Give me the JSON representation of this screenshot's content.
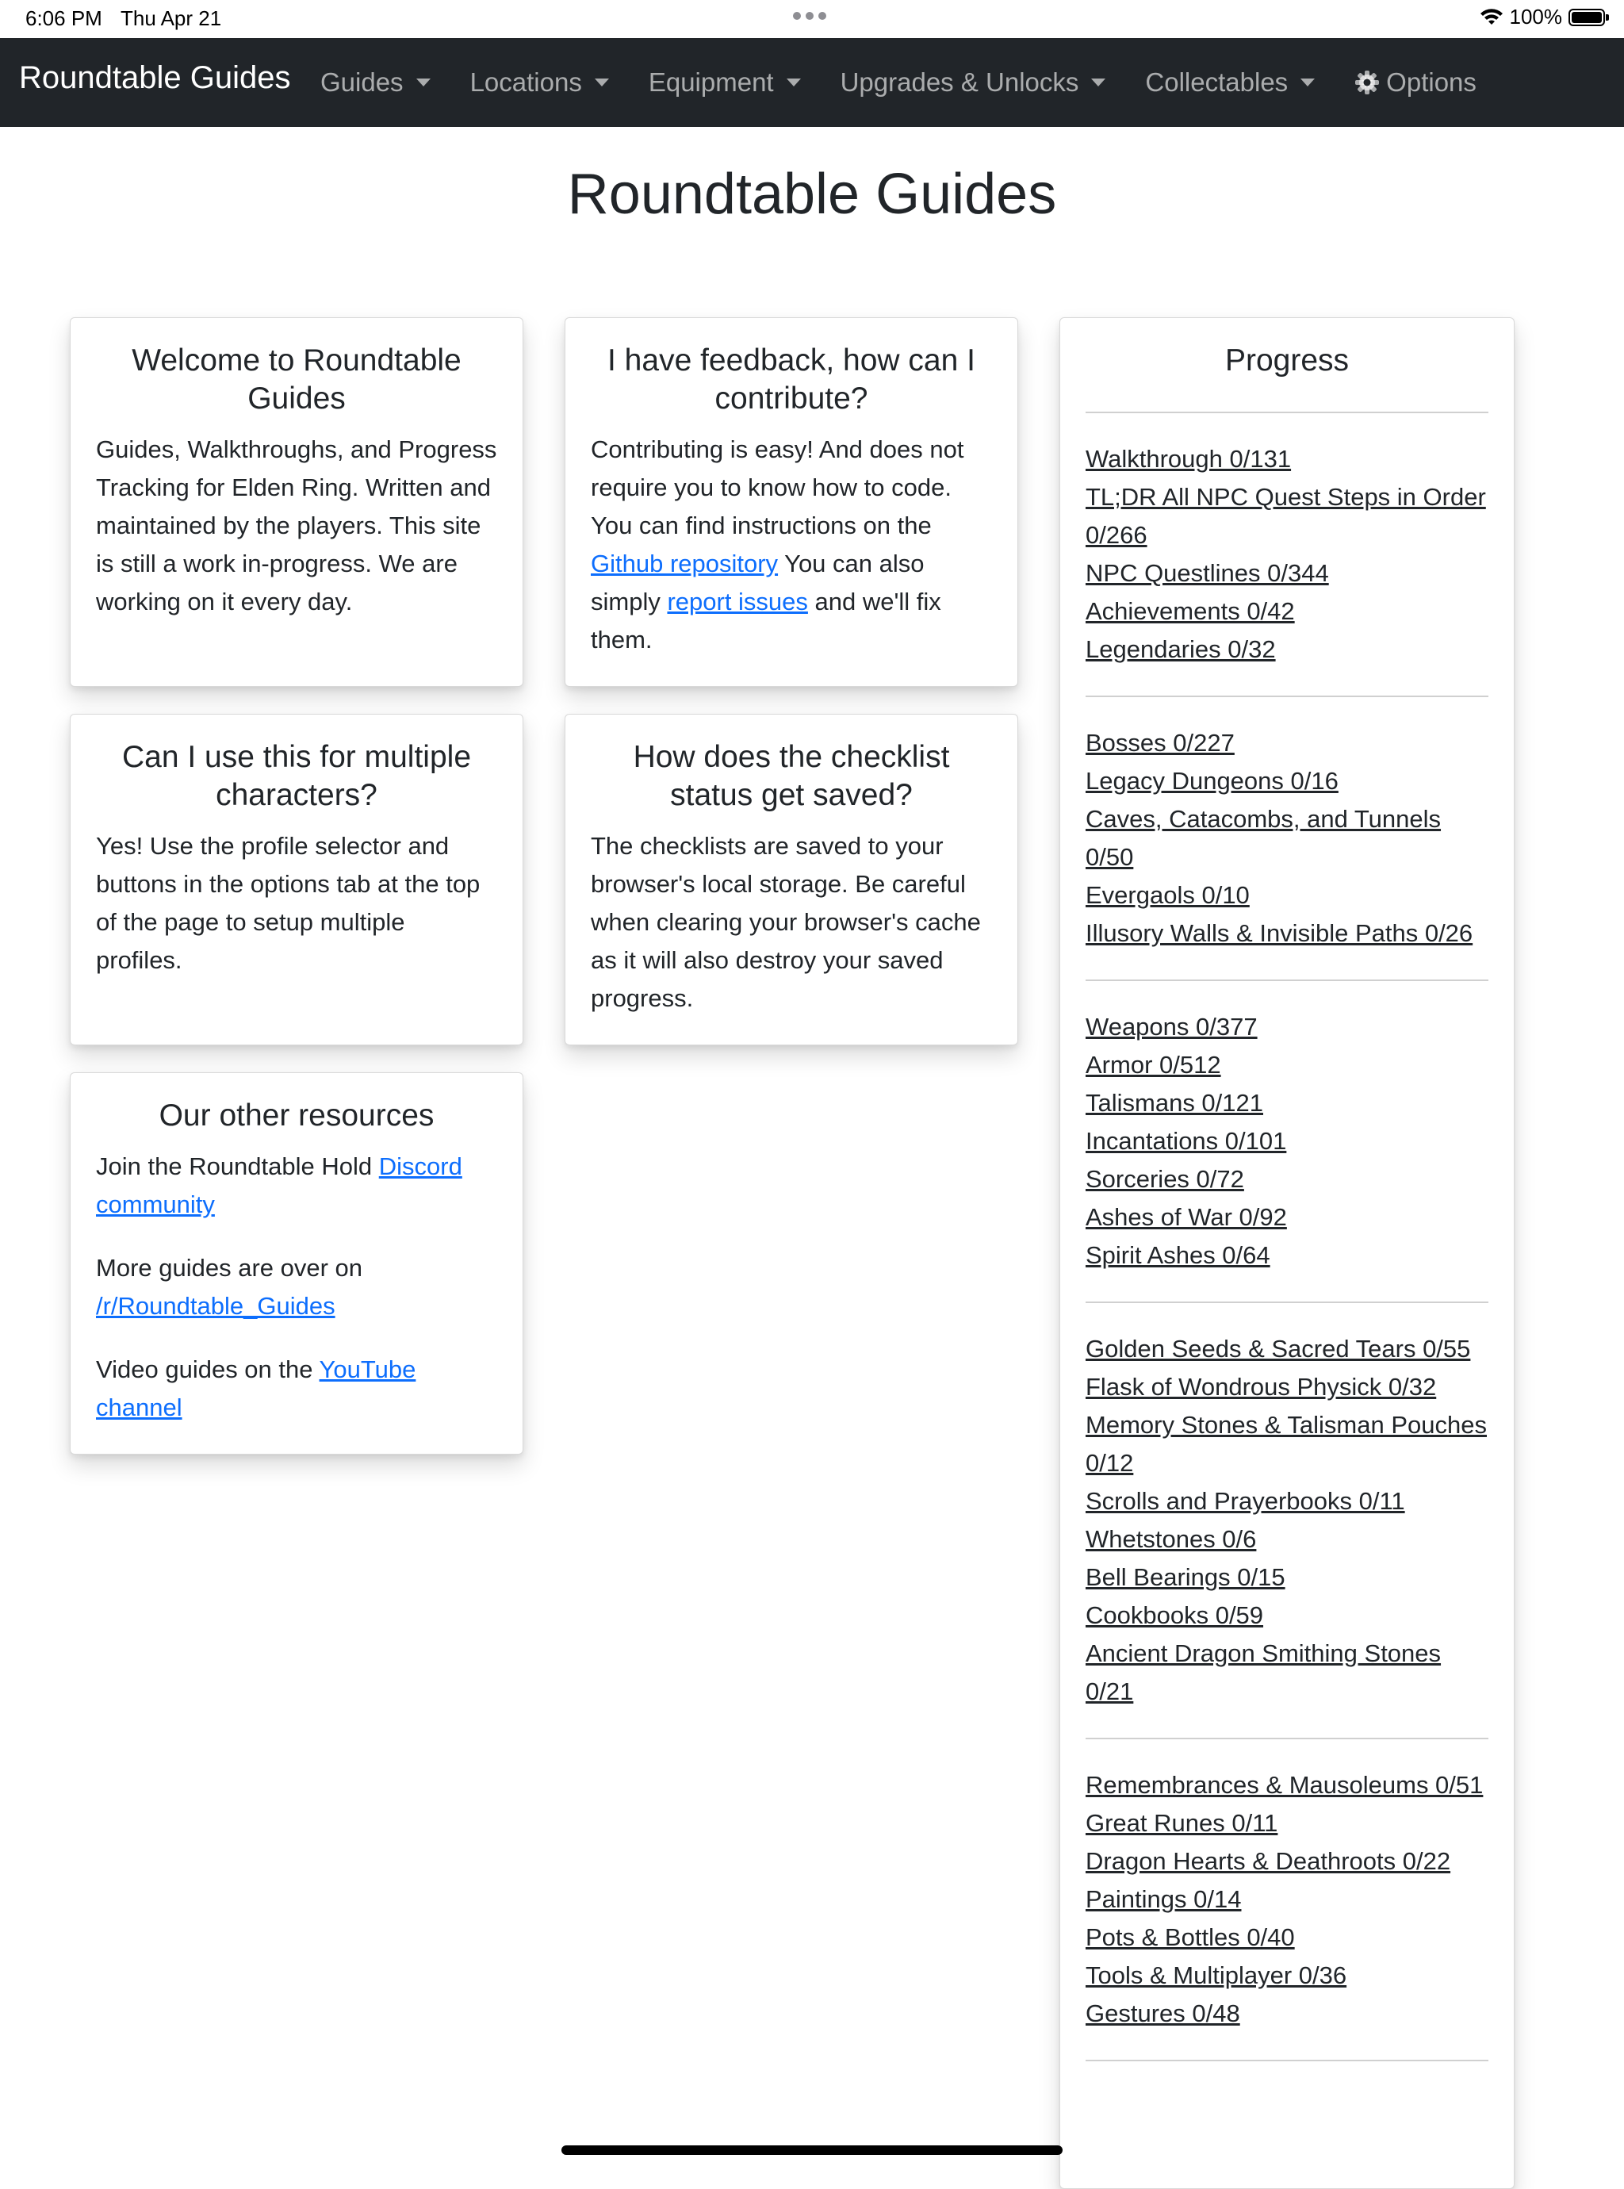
{
  "status_bar": {
    "time": "6:06 PM",
    "date": "Thu Apr 21",
    "battery": "100%"
  },
  "navbar": {
    "brand": "Roundtable Guides",
    "items": [
      {
        "label": "Guides"
      },
      {
        "label": "Locations"
      },
      {
        "label": "Equipment"
      },
      {
        "label": "Upgrades & Unlocks"
      },
      {
        "label": "Collectables"
      },
      {
        "label": "Options"
      }
    ]
  },
  "page_title": "Roundtable Guides",
  "cards": {
    "welcome": {
      "title": "Welcome to Roundtable Guides",
      "text": "Guides, Walkthroughs, and Progress Tracking for Elden Ring. Written and maintained by the players. This site is still a work in-progress. We are working on it every day."
    },
    "feedback": {
      "title": "I have feedback, how can I contribute?",
      "text1": "Contributing is easy! And does not require you to know how to code. You can find instructions on the ",
      "link1": "Github repository",
      "text2": " You can also simply ",
      "link2": "report issues",
      "text3": " and we'll fix them."
    },
    "multiple": {
      "title": "Can I use this for multiple characters?",
      "text": "Yes! Use the profile selector and buttons in the options tab at the top of the page to setup multiple profiles."
    },
    "checklist": {
      "title": "How does the checklist status get saved?",
      "text": "The checklists are saved to your browser's local storage. Be careful when clearing your browser's cache as it will also destroy your saved progress."
    },
    "resources": {
      "title": "Our other resources",
      "discord_pre": "Join the Roundtable Hold ",
      "discord_link": "Discord community",
      "reddit_pre": "More guides are over on ",
      "reddit_link": "/r/Roundtable_Guides",
      "youtube_pre": "Video guides on the ",
      "youtube_link": "YouTube channel"
    }
  },
  "progress": {
    "title": "Progress",
    "groups": [
      [
        "Walkthrough 0/131",
        "TL;DR All NPC Quest Steps in Order 0/266",
        "NPC Questlines 0/344",
        "Achievements 0/42",
        "Legendaries 0/32"
      ],
      [
        "Bosses 0/227",
        "Legacy Dungeons 0/16",
        "Caves, Catacombs, and Tunnels 0/50",
        "Evergaols 0/10",
        "Illusory Walls & Invisible Paths 0/26"
      ],
      [
        "Weapons 0/377",
        "Armor 0/512",
        "Talismans 0/121",
        "Incantations 0/101",
        "Sorceries 0/72",
        "Ashes of War 0/92",
        "Spirit Ashes 0/64"
      ],
      [
        "Golden Seeds & Sacred Tears 0/55",
        "Flask of Wondrous Physick 0/32",
        "Memory Stones & Talisman Pouches 0/12",
        "Scrolls and Prayerbooks 0/11",
        "Whetstones 0/6",
        "Bell Bearings 0/15",
        "Cookbooks 0/59",
        "Ancient Dragon Smithing Stones 0/21"
      ],
      [
        "Remembrances & Mausoleums 0/51",
        "Great Runes 0/11",
        "Dragon Hearts & Deathroots 0/22",
        "Paintings 0/14",
        "Pots & Bottles 0/40",
        "Tools & Multiplayer 0/36",
        "Gestures 0/48"
      ]
    ]
  }
}
